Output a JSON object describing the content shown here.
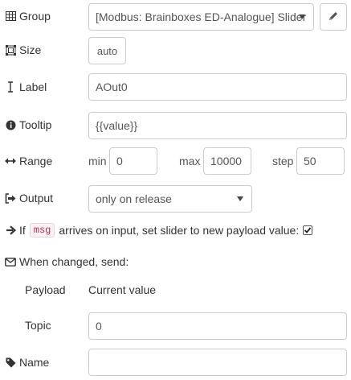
{
  "group": {
    "label": "Group",
    "value": "[Modbus: Brainboxes ED-Analogue] Slider",
    "edit_icon": "pencil-icon"
  },
  "size": {
    "label": "Size",
    "value": "auto"
  },
  "label_row": {
    "label": "Label",
    "value": "AOut0"
  },
  "tooltip": {
    "label": "Tooltip",
    "value": "{{value}}"
  },
  "range": {
    "label": "Range",
    "min_label": "min",
    "min_value": "0",
    "max_label": "max",
    "max_value": "10000",
    "step_label": "step",
    "step_value": "50"
  },
  "output": {
    "label": "Output",
    "value": "only on release"
  },
  "passthrough": {
    "prefix": "If",
    "code": "msg",
    "text": "arrives on input, set slider to new payload value:",
    "checked": true
  },
  "when_changed": {
    "label": "When changed, send:"
  },
  "payload": {
    "label": "Payload",
    "value": "Current value"
  },
  "topic": {
    "label": "Topic",
    "value": "0"
  },
  "name": {
    "label": "Name",
    "value": ""
  }
}
